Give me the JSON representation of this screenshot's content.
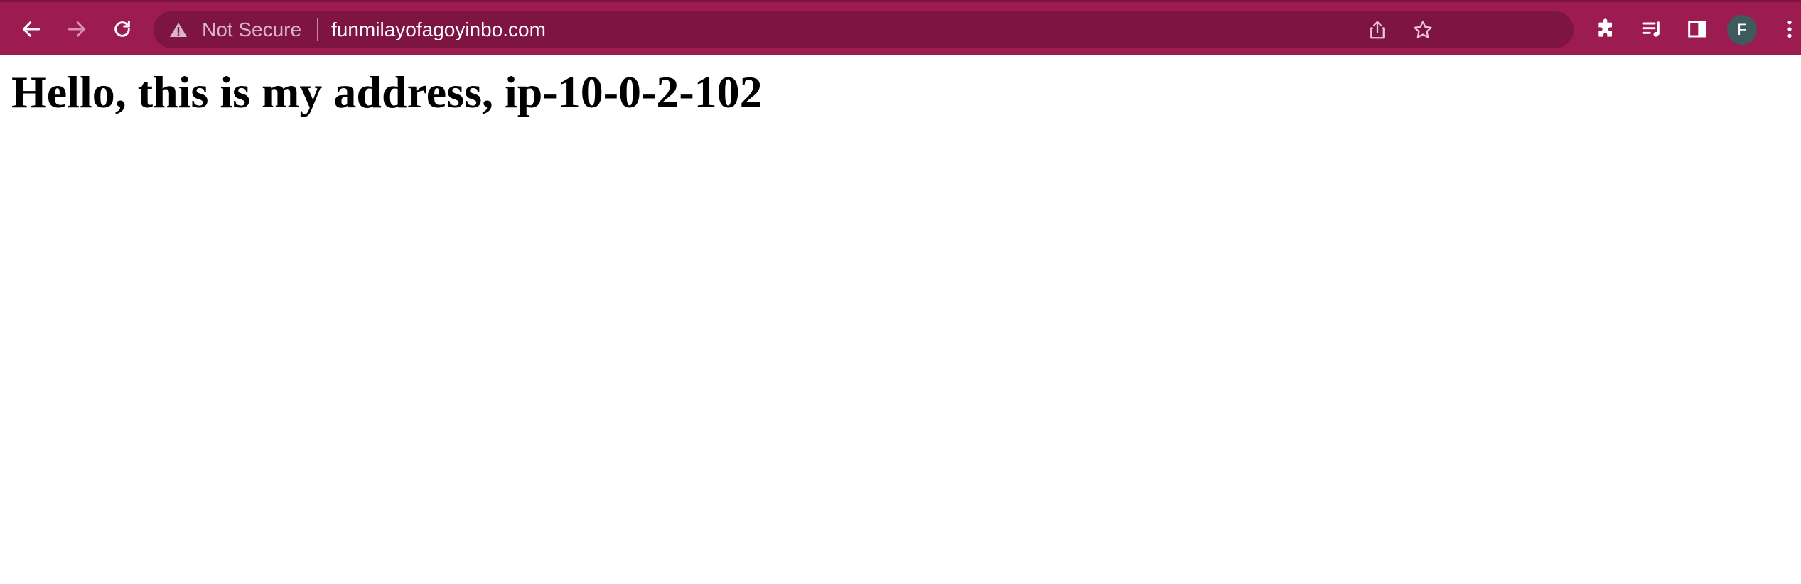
{
  "browser": {
    "security_label": "Not Secure",
    "url": "funmilayofagoyinbo.com",
    "profile_initial": "F",
    "toolbar_color": "#9c1b50",
    "omnibox_color": "#7e1442"
  },
  "page": {
    "heading": "Hello, this is my address, ip-10-0-2-102"
  }
}
